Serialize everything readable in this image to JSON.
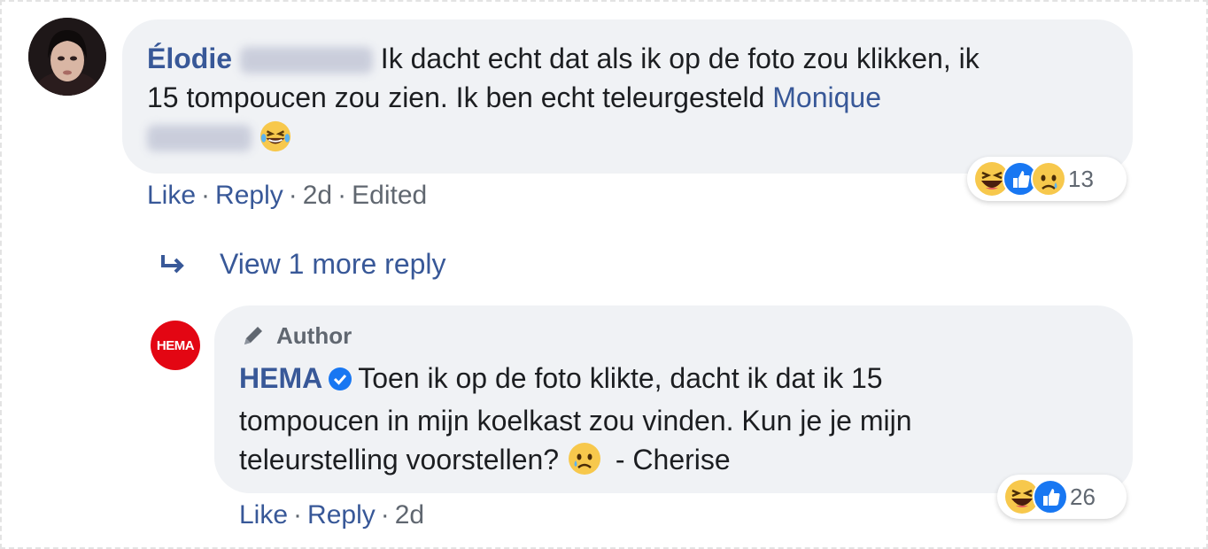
{
  "comment1": {
    "author_first": "Élodie",
    "text_1": "Ik dacht echt dat als ik op de foto zou klikken, ik",
    "text_2": "15 tompoucen zou zien. Ik ben echt teleurgesteld",
    "mention_first": "Monique",
    "emoji": "laughing-tears",
    "actions": {
      "like": "Like",
      "reply": "Reply",
      "time": "2d",
      "edited": "Edited"
    },
    "reactions": {
      "types": [
        "haha",
        "like",
        "sad"
      ],
      "count": "13"
    }
  },
  "view_more": {
    "label": "View 1 more reply"
  },
  "reply": {
    "avatar_text": "HEMA",
    "badge": "Author",
    "author_name": "HEMA",
    "verified": true,
    "text_1": "Toen ik op de foto klikte, dacht ik dat ik 15",
    "text_2": "tompoucen in mijn koelkast zou vinden. Kun je je mijn",
    "text_3": "teleurstelling voorstellen?",
    "emoji": "sad-tear",
    "signature": "- Cherise",
    "actions": {
      "like": "Like",
      "reply": "Reply",
      "time": "2d"
    },
    "reactions": {
      "types": [
        "haha",
        "like"
      ],
      "count": "26"
    }
  },
  "colors": {
    "link": "#385898",
    "bubble": "#f0f2f5",
    "meta": "#606770",
    "hema_red": "#e30613",
    "like_blue": "#1877f2"
  }
}
